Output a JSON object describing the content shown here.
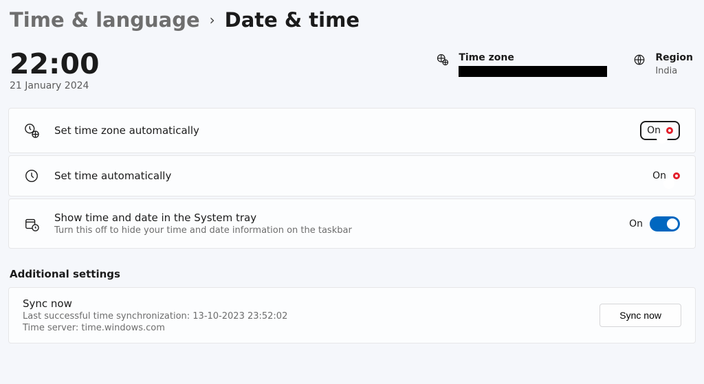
{
  "breadcrumb": {
    "parent": "Time & language",
    "current": "Date & time"
  },
  "clock": {
    "time": "22:00",
    "date": "21 January 2024"
  },
  "header": {
    "timezone_label": "Time zone",
    "region_label": "Region",
    "region_value": "India"
  },
  "settings": {
    "set_tz_auto": {
      "title": "Set time zone automatically",
      "state_text": "On"
    },
    "set_time_auto": {
      "title": "Set time automatically",
      "state_text": "On"
    },
    "show_tray": {
      "title": "Show time and date in the System tray",
      "subtitle": "Turn this off to hide your time and date information on the taskbar",
      "state_text": "On"
    }
  },
  "additional": {
    "section_title": "Additional settings",
    "sync_title": "Sync now",
    "last_sync": "Last successful time synchronization: 13-10-2023 23:52:02",
    "time_server": "Time server: time.windows.com",
    "button": "Sync now"
  }
}
